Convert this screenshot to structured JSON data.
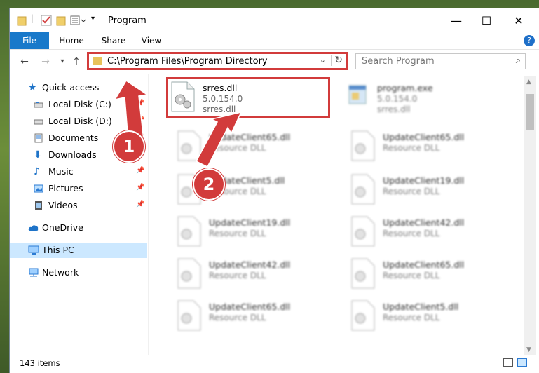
{
  "window": {
    "title": "Program",
    "tabs": {
      "file": "File",
      "home": "Home",
      "share": "Share",
      "view": "View"
    },
    "help": "?"
  },
  "address": {
    "path": "C:\\Program Files\\Program Directory"
  },
  "search": {
    "placeholder": "Search Program"
  },
  "sidebar": {
    "quick_access": "Quick access",
    "items": [
      {
        "label": "Local Disk (C:)"
      },
      {
        "label": "Local Disk (D:)"
      },
      {
        "label": "Documents"
      },
      {
        "label": "Downloads"
      },
      {
        "label": "Music"
      },
      {
        "label": "Pictures"
      },
      {
        "label": "Videos"
      }
    ],
    "onedrive": "OneDrive",
    "this_pc": "This PC",
    "network": "Network"
  },
  "files": [
    {
      "name": "srres.dll",
      "line2": "5.0.154.0",
      "line3": "srres.dll"
    },
    {
      "name": "program.exe",
      "line2": "5.0.154.0",
      "line3": "srres.dll"
    },
    {
      "name": "UpdateClient65.dll",
      "line2": "Resource DLL"
    },
    {
      "name": "UpdateClient65.dll",
      "line2": "Resource DLL"
    },
    {
      "name": "UpdateClient5.dll",
      "line2": "Resource DLL"
    },
    {
      "name": "UpdateClient19.dll",
      "line2": "Resource DLL"
    },
    {
      "name": "UpdateClient19.dll",
      "line2": "Resource DLL"
    },
    {
      "name": "UpdateClient42.dll",
      "line2": "Resource DLL"
    },
    {
      "name": "UpdateClient42.dll",
      "line2": "Resource DLL"
    },
    {
      "name": "UpdateClient65.dll",
      "line2": "Resource DLL"
    },
    {
      "name": "UpdateClient65.dll",
      "line2": "Resource DLL"
    },
    {
      "name": "UpdateClient5.dll",
      "line2": "Resource DLL"
    }
  ],
  "status": {
    "count": "143 items"
  },
  "annotations": {
    "step1": "1",
    "step2": "2"
  },
  "colors": {
    "accent": "#1979ca",
    "highlight": "#d23b3b",
    "selected": "#cce8ff"
  }
}
